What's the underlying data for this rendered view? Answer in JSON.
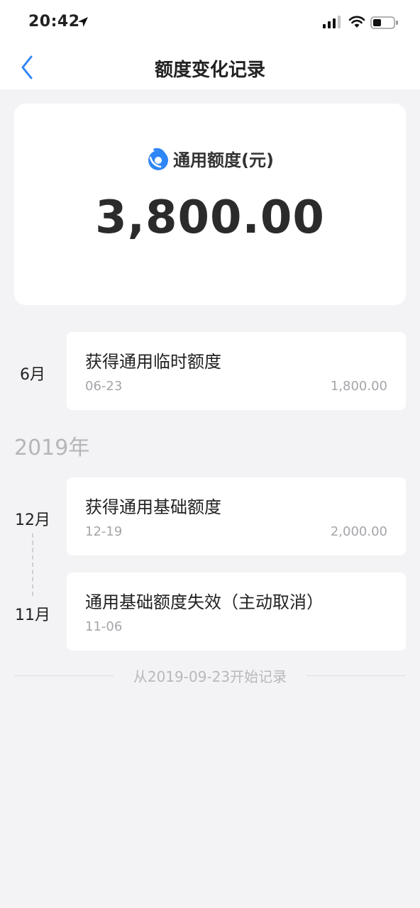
{
  "status_bar": {
    "time": "20:42"
  },
  "nav": {
    "title": "额度变化记录"
  },
  "summary": {
    "label": "通用额度(元)",
    "amount": "3,800.00"
  },
  "records": [
    {
      "month": "6月",
      "title": "获得通用临时额度",
      "date": "06-23",
      "amount": "1,800.00"
    },
    {
      "year": "2019年"
    },
    {
      "month": "12月",
      "title": "获得通用基础额度",
      "date": "12-19",
      "amount": "2,000.00"
    },
    {
      "month": "11月",
      "title": "通用基础额度失效（主动取消）",
      "date": "11-06",
      "amount": ""
    }
  ],
  "footer": {
    "note": "从2019-09-23开始记录"
  },
  "colors": {
    "accent": "#2f86f6",
    "background": "#f3f3f5",
    "muted": "#a5a5aa"
  }
}
